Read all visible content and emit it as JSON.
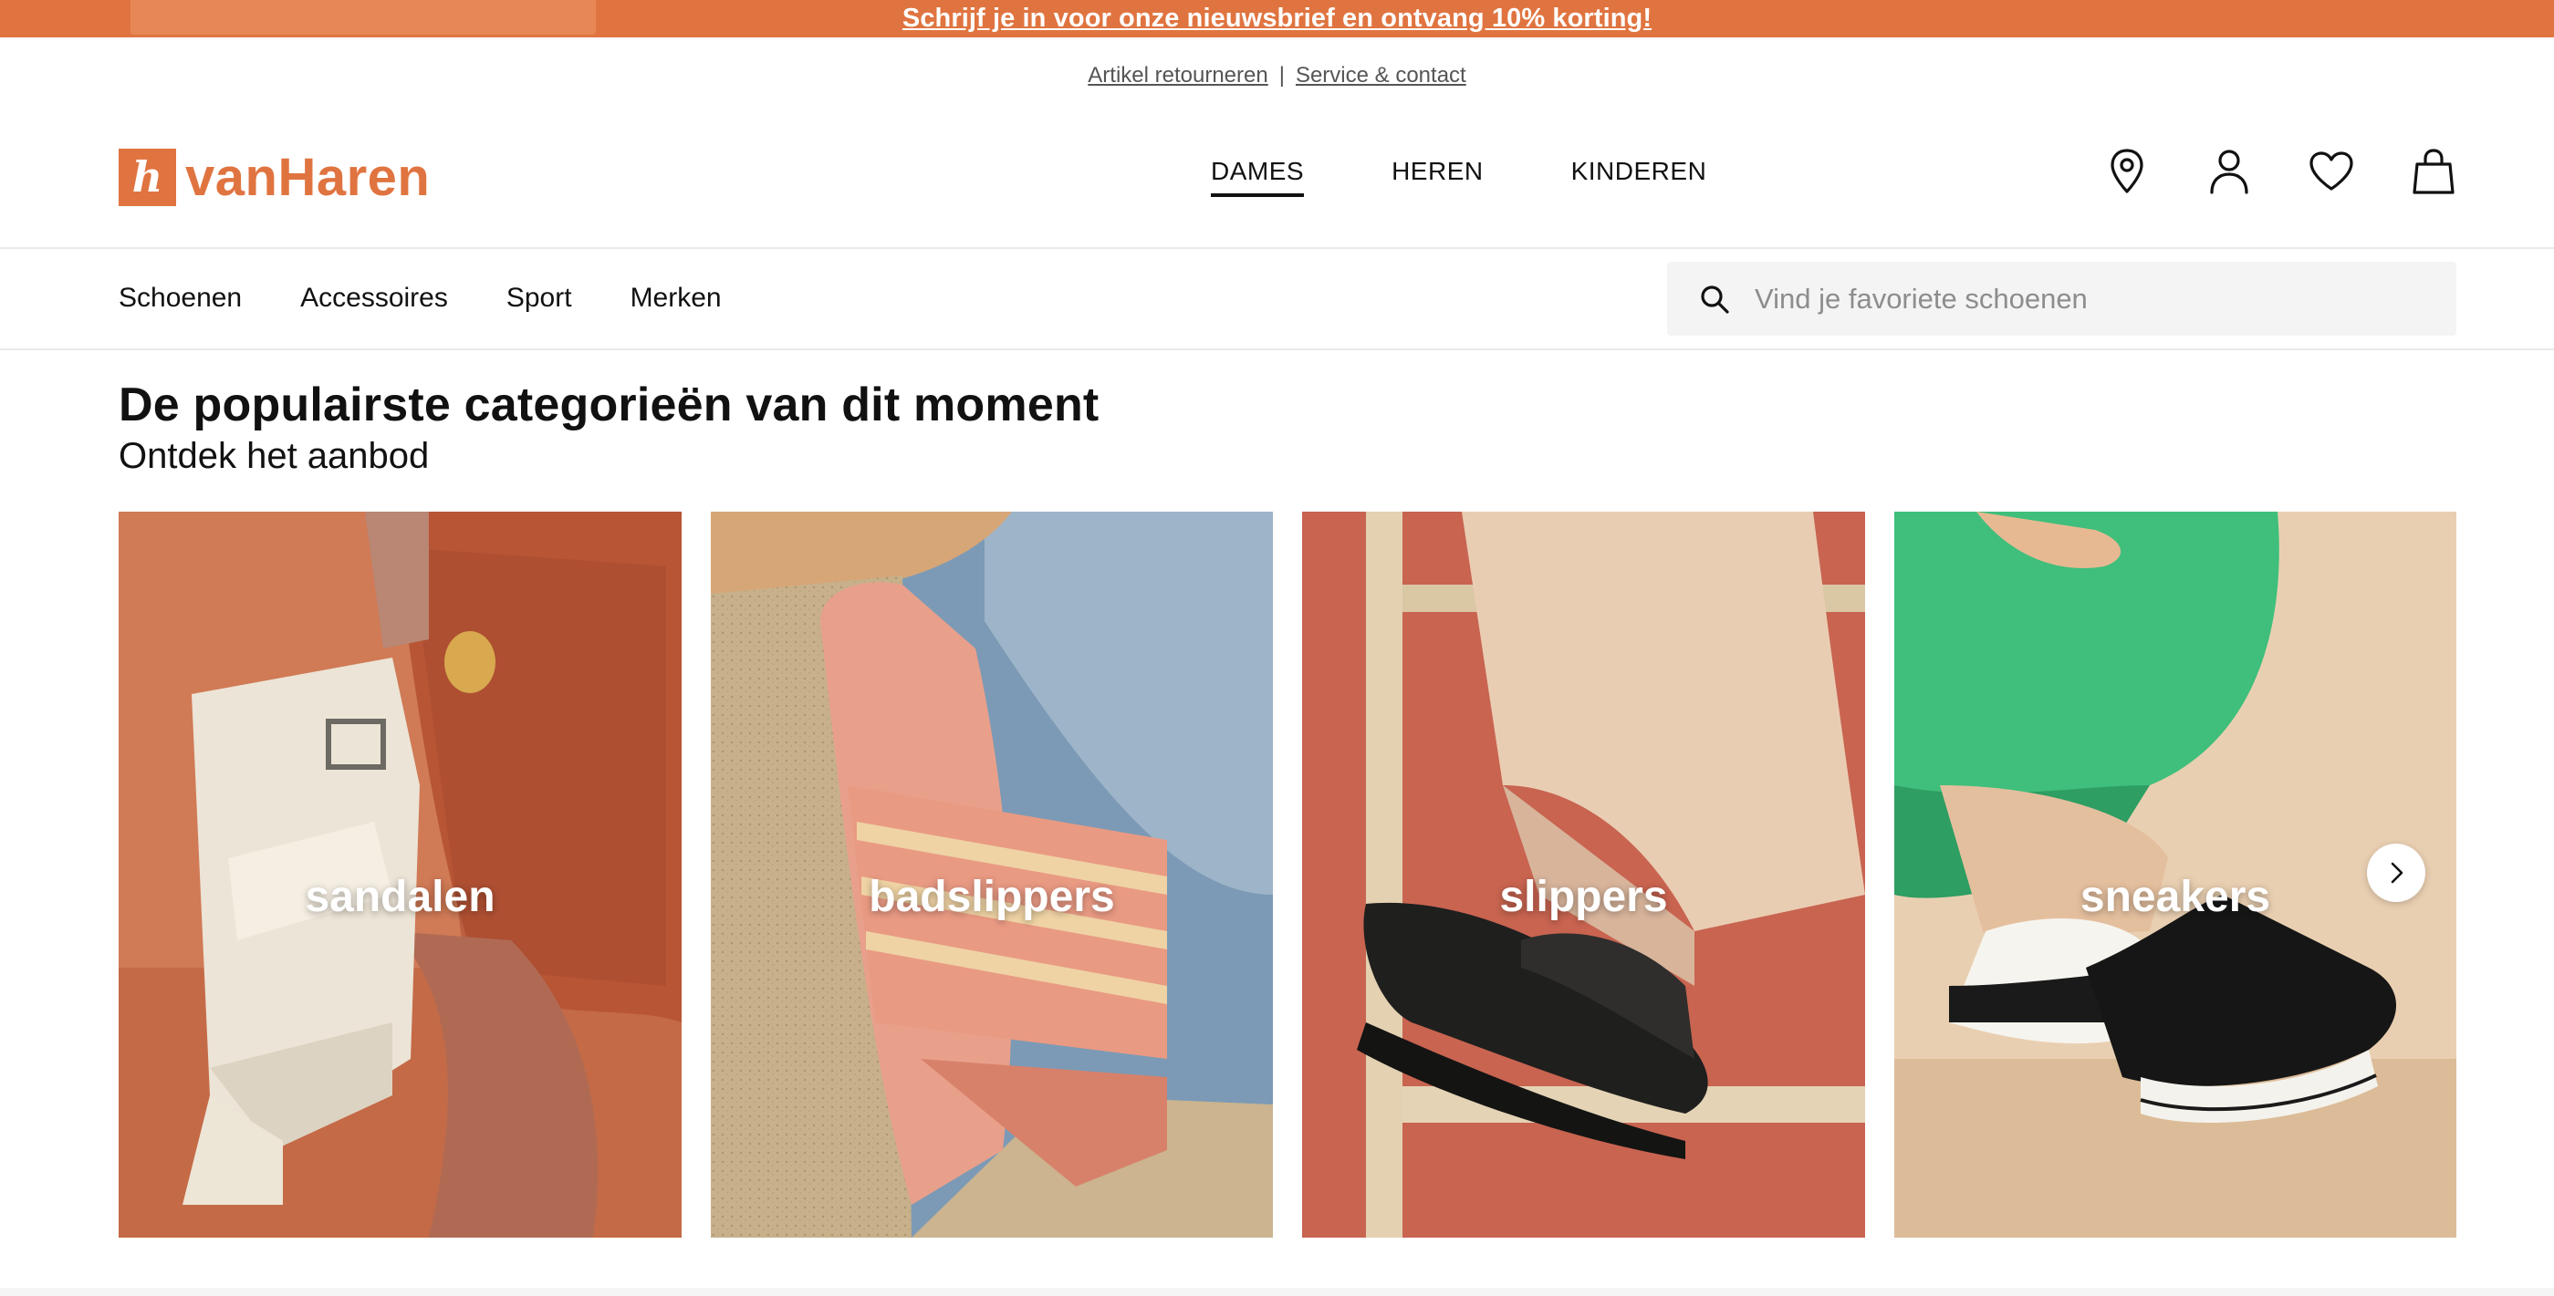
{
  "promo": {
    "text": "Schrijf je in voor onze nieuwsbrief en ontvang 10% korting!",
    "background_color": "#e07440"
  },
  "utility_links": {
    "returns": "Artikel retourneren",
    "separator": "|",
    "service": "Service & contact"
  },
  "brand": {
    "logo_mark": "h",
    "name": "vanHaren",
    "color": "#e07440"
  },
  "gender_nav": {
    "items": [
      {
        "label": "DAMES",
        "active": true
      },
      {
        "label": "HEREN",
        "active": false
      },
      {
        "label": "KINDEREN",
        "active": false
      }
    ]
  },
  "header_icons": [
    {
      "name": "location-pin-icon"
    },
    {
      "name": "user-icon"
    },
    {
      "name": "heart-icon"
    },
    {
      "name": "shopping-bag-icon"
    }
  ],
  "category_nav": {
    "items": [
      "Schoenen",
      "Accessoires",
      "Sport",
      "Merken"
    ]
  },
  "search": {
    "placeholder": "Vind je favoriete schoenen",
    "value": ""
  },
  "section": {
    "title": "De populairste categorieën van dit moment",
    "subtitle": "Ontdek het aanbod"
  },
  "categories": [
    {
      "label": "sandalen"
    },
    {
      "label": "badslippers"
    },
    {
      "label": "slippers"
    },
    {
      "label": "sneakers"
    }
  ],
  "carousel": {
    "next_icon": "chevron-right-icon"
  }
}
